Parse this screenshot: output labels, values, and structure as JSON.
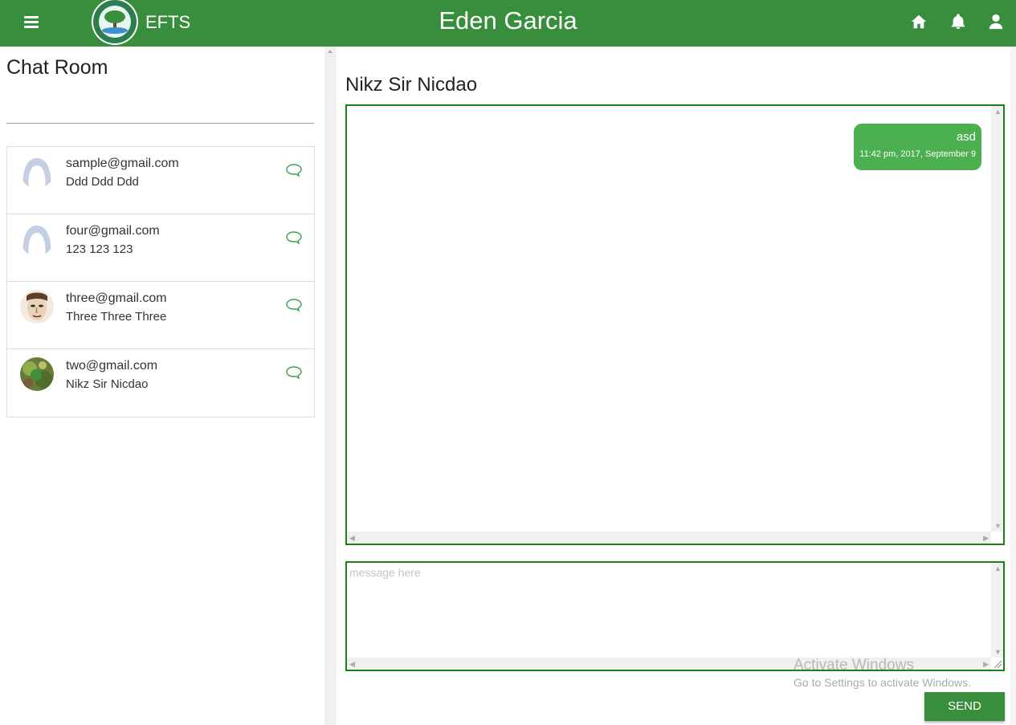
{
  "header": {
    "brand": "EFTS",
    "title": "Eden Garcia",
    "icons": [
      "home-icon",
      "bell-icon",
      "user-icon"
    ],
    "color": "#388e3c"
  },
  "sidebar": {
    "title": "Chat Room",
    "contacts": [
      {
        "email": "sample@gmail.com",
        "name": "Ddd Ddd Ddd",
        "avatar": "default-avatar"
      },
      {
        "email": "four@gmail.com",
        "name": "123 123 123",
        "avatar": "default-avatar"
      },
      {
        "email": "three@gmail.com",
        "name": "Three Three Three",
        "avatar": "face-photo"
      },
      {
        "email": "two@gmail.com",
        "name": "Nikz Sir Nicdao",
        "avatar": "nature-photo"
      }
    ]
  },
  "conversation": {
    "title": "Nikz Sir Nicdao",
    "messages": [
      {
        "text": "asd",
        "time": "11:42 pm, 2017, September 9"
      }
    ]
  },
  "composer": {
    "placeholder": "message here",
    "value": "",
    "send_label": "SEND"
  },
  "watermark": {
    "title": "Activate Windows",
    "subtitle": "Go to Settings to activate Windows."
  },
  "colors": {
    "accent": "#388e3c",
    "bubble": "#4caf50",
    "border": "#1b7f1b"
  }
}
